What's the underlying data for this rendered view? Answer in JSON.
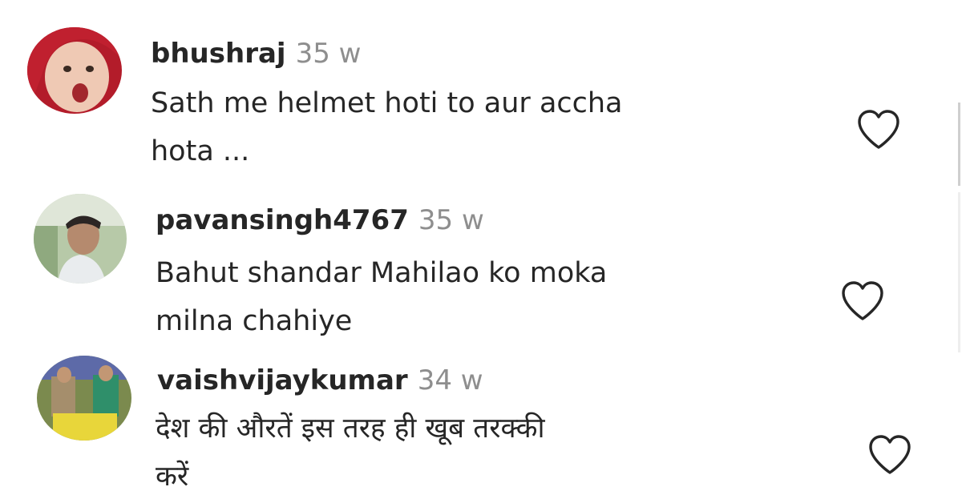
{
  "comments": [
    {
      "username": "bhushraj",
      "time": "35 w",
      "line1": "Sath me helmet hoti to aur accha",
      "line2": "hota ...",
      "avatar_icon": "avatar-child-red-scarf",
      "heart_icon": "heart-outline-icon"
    },
    {
      "username": "pavansingh4767",
      "time": "35 w",
      "line1": "Bahut shandar Mahilao ko moka",
      "line2": "milna chahiye",
      "avatar_icon": "avatar-man-outdoor",
      "heart_icon": "heart-outline-icon"
    },
    {
      "username": "vaishvijaykumar",
      "time": "34 w",
      "line1": "देश की औरतें इस तरह ही खूब तरक्की",
      "line2": "करें",
      "avatar_icon": "avatar-group-photo",
      "heart_icon": "heart-outline-icon"
    }
  ],
  "colors": {
    "text": "#262626",
    "muted": "#8e8e8e",
    "heart_stroke": "#262626"
  }
}
